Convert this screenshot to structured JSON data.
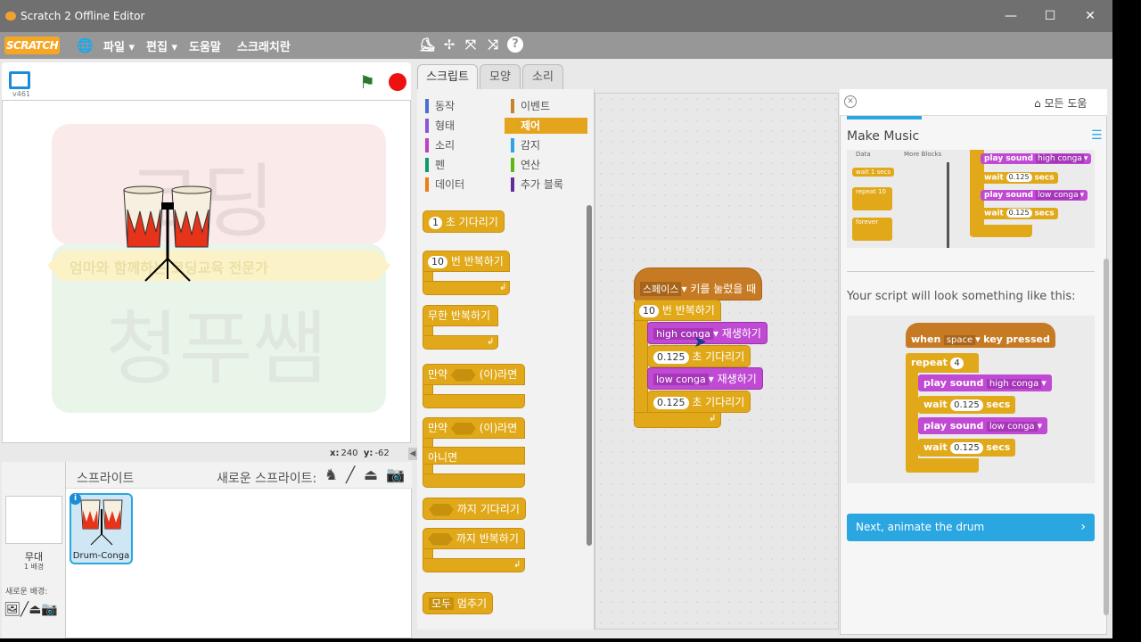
{
  "window": {
    "title": "Scratch 2 Offline Editor"
  },
  "menubar": {
    "logo": "SCRATCH",
    "file": "파일 ▾",
    "edit": "편집 ▾",
    "help": "도움말",
    "scratch_tips": "스크래치란"
  },
  "stage": {
    "version": "v461",
    "coords_x_label": "x:",
    "coords_x": "240",
    "coords_y_label": "y:",
    "coords_y": "-62",
    "watermark_top": "코딩",
    "watermark_sub": "엄마와 함께하는 코딩교육 전문가",
    "watermark_bottom": "청푸쌤"
  },
  "sprites": {
    "title": "스프라이트",
    "new_sprite": "새로운 스프라이트:",
    "stage_label": "무대",
    "stage_sub": "1 배경",
    "new_backdrop": "새로운 배경:",
    "sprite_name": "Drum-Conga"
  },
  "tabs": {
    "scripts": "스크립트",
    "costumes": "모양",
    "sounds": "소리"
  },
  "categories": [
    {
      "label": "동작",
      "color": "#4a6cd4"
    },
    {
      "label": "형태",
      "color": "#8a55d7"
    },
    {
      "label": "소리",
      "color": "#bb42c3"
    },
    {
      "label": "펜",
      "color": "#0e9a6c"
    },
    {
      "label": "데이터",
      "color": "#ee7d16"
    },
    {
      "label": "이벤트",
      "color": "#c88330"
    },
    {
      "label": "제어",
      "color": "#e1a91a"
    },
    {
      "label": "감지",
      "color": "#2ca5e2"
    },
    {
      "label": "연산",
      "color": "#5cb712"
    },
    {
      "label": "추가 블록",
      "color": "#632d99"
    }
  ],
  "palette": {
    "wait_num": "1",
    "wait_label": "초 기다리기",
    "repeat_num": "10",
    "repeat_label": "번 반복하기",
    "forever_label": "무한 반복하기",
    "if_label": "만약",
    "then_label": "(이)라면",
    "if2_label": "만약",
    "then2_label": "(이)라면",
    "else_label": "아니면",
    "wait_until_label": "까지 기다리기",
    "repeat_until_label": "까지 반복하기",
    "stop_dd": "모두",
    "stop_label": "멈추기"
  },
  "script": {
    "hat_key": "스페이스",
    "hat_label": "키를 눌렀을 때",
    "repeat_num": "10",
    "repeat_label": "번 반복하기",
    "sound1": "high conga",
    "play_label": "재생하기",
    "wait1_num": "0.125",
    "wait_label": "초 기다리기",
    "sound2": "low conga",
    "wait2_num": "0.125"
  },
  "tips": {
    "home": "모든 도움",
    "title": "Make Music",
    "img1_data": "Data",
    "img1_more": "More Blocks",
    "img1_wait": "wait 1 secs",
    "img1_repeat": "repeat 10",
    "img1_forever": "forever",
    "img1_play1": "play sound",
    "img1_dd1": "high conga",
    "img1_wait_a": "wait",
    "img1_num": "0.125",
    "img1_secs": "secs",
    "img1_dd2": "low conga",
    "text": "Your script will look something like this:",
    "ex_when": "when",
    "ex_key": "space",
    "ex_pressed": "key pressed",
    "ex_repeat": "repeat",
    "ex_repeat_num": "4",
    "ex_play": "play sound",
    "ex_dd1": "high conga",
    "ex_wait": "wait",
    "ex_num": "0.125",
    "ex_secs": "secs",
    "ex_dd2": "low conga",
    "next": "Next, animate the drum"
  }
}
